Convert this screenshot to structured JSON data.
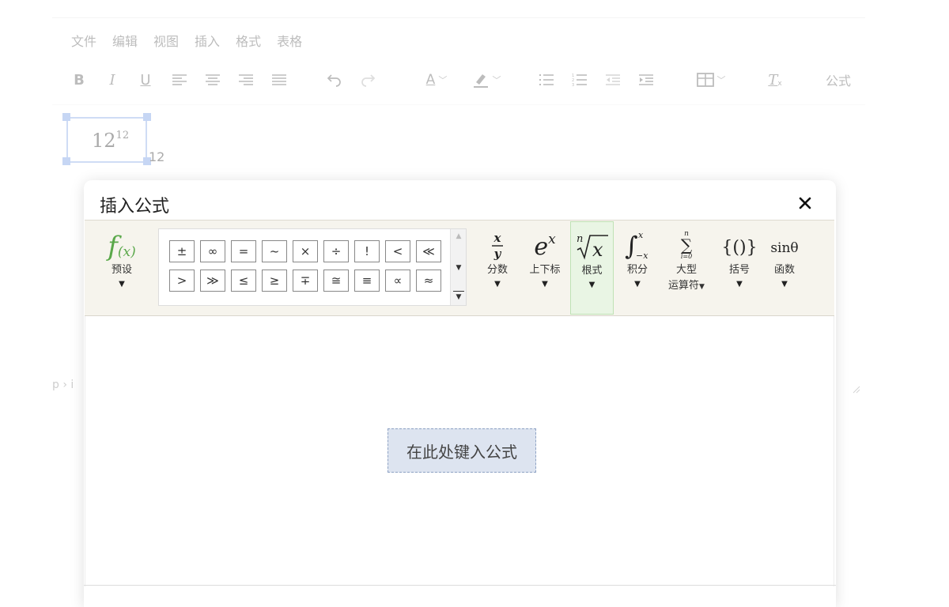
{
  "editor": {
    "menu": [
      "文件",
      "编辑",
      "视图",
      "插入",
      "格式",
      "表格"
    ],
    "toolbar": {
      "bold_icon": "B",
      "italic_icon": "I",
      "underline_icon": "U",
      "font_color_icon": "A",
      "clear_format_icon": "T",
      "clear_format_sub": "x",
      "formula_label": "公式"
    },
    "statusbar_path": "p › i"
  },
  "document": {
    "formula_base": "12",
    "formula_sup": "12",
    "after_text": "12"
  },
  "dialog": {
    "title": "插入公式",
    "close_icon": "✕",
    "presets": {
      "icon_text": "f(x)",
      "label": "预设"
    },
    "symbols": [
      "±",
      "∞",
      "=",
      "~",
      "×",
      "÷",
      "!",
      "<",
      "≪",
      ">",
      "≫",
      "≤",
      "≥",
      "∓",
      "≅",
      "≡",
      "∝",
      "≈"
    ],
    "groups": [
      {
        "id": "fraction",
        "label": "分数",
        "icon": "x/y"
      },
      {
        "id": "script",
        "label": "上下标",
        "icon": "e^x"
      },
      {
        "id": "radical",
        "label": "根式",
        "icon": "ⁿ√x",
        "active": true
      },
      {
        "id": "integral",
        "label": "积分",
        "icon": "∫"
      },
      {
        "id": "large-operator",
        "label": "大型",
        "label2": "运算符",
        "icon": "∑"
      },
      {
        "id": "bracket",
        "label": "括号",
        "icon": "{()}"
      },
      {
        "id": "function",
        "label": "函数",
        "icon": "sinθ"
      }
    ],
    "placeholder": "在此处键入公式"
  },
  "colors": {
    "toolbar_bg": "#f6f4ed",
    "active_group_bg": "#e9f5e4",
    "preset_green": "#5aa84a",
    "placeholder_bg": "#dde4f0"
  }
}
